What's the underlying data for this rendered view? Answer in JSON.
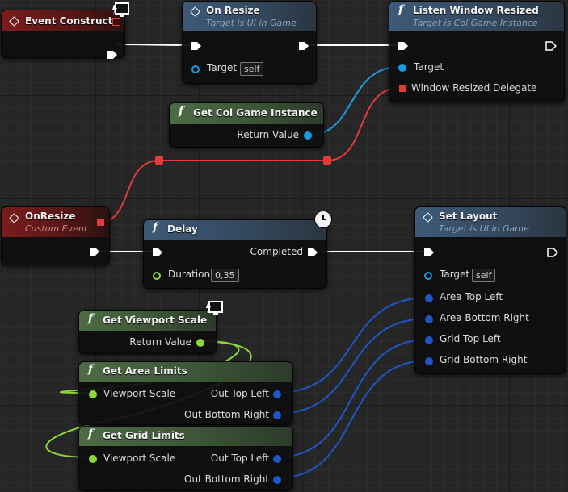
{
  "nodes": {
    "event_construct": {
      "title": "Event Construct"
    },
    "on_resize_call": {
      "title": "On Resize",
      "subtitle": "Target is UI in Game",
      "target_label": "Target",
      "target_value": "self"
    },
    "listen_window_resized": {
      "title": "Listen Window Resized",
      "subtitle": "Target is Col Game Instance",
      "target_label": "Target",
      "delegate_label": "Window Resized Delegate"
    },
    "get_col_game_instance": {
      "title": "Get Col Game Instance",
      "return_label": "Return Value"
    },
    "on_resize_event": {
      "title": "OnResize",
      "subtitle": "Custom Event"
    },
    "delay": {
      "title": "Delay",
      "completed_label": "Completed",
      "duration_label": "Duration",
      "duration_value": "0,35"
    },
    "set_layout": {
      "title": "Set Layout",
      "subtitle": "Target is UI in Game",
      "target_label": "Target",
      "target_value": "self",
      "pins": [
        "Area Top Left",
        "Area Bottom Right",
        "Grid Top Left",
        "Grid Bottom Right"
      ]
    },
    "get_viewport_scale": {
      "title": "Get Viewport Scale",
      "return_label": "Return Value"
    },
    "get_area_limits": {
      "title": "Get Area Limits",
      "in_label": "Viewport Scale",
      "out_top_left": "Out Top Left",
      "out_bottom_right": "Out Bottom Right"
    },
    "get_grid_limits": {
      "title": "Get Grid Limits",
      "in_label": "Viewport Scale",
      "out_top_left": "Out Top Left",
      "out_bottom_right": "Out Bottom Right"
    }
  },
  "colors": {
    "exec_wire": "#ffffff",
    "object_wire": "#1a9be0",
    "delegate_wire": "#e23b3b",
    "struct_wire": "#1f55c4",
    "float_wire": "#8ed63c"
  },
  "icons": [
    "event-diamond-icon",
    "function-f-icon",
    "clock-icon",
    "client-only-monitor-icon"
  ]
}
